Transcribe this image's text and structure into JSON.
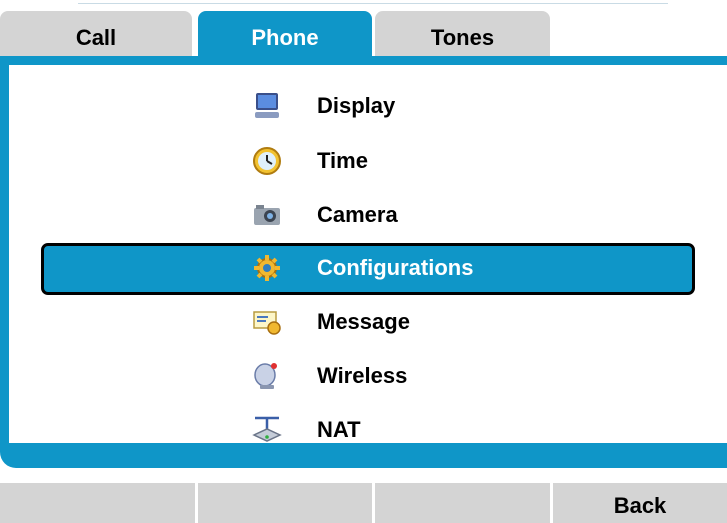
{
  "tabs": [
    {
      "label": "Call",
      "active": false
    },
    {
      "label": "Phone",
      "active": true
    },
    {
      "label": "Tones",
      "active": false
    }
  ],
  "menu": {
    "items": [
      {
        "label": "Display",
        "icon": "monitor-icon"
      },
      {
        "label": "Time",
        "icon": "clock-icon"
      },
      {
        "label": "Camera",
        "icon": "camera-icon"
      },
      {
        "label": "Configurations",
        "icon": "gear-icon",
        "selected": true
      },
      {
        "label": "Message",
        "icon": "message-icon"
      },
      {
        "label": "Wireless",
        "icon": "satellite-dish-icon"
      },
      {
        "label": "NAT",
        "icon": "router-icon"
      }
    ]
  },
  "softkeys": [
    "",
    "",
    "",
    "Back"
  ],
  "colors": {
    "accent": "#0f96c8",
    "tab_inactive": "#d4d4d4",
    "softkey": "#d4d4d4"
  }
}
